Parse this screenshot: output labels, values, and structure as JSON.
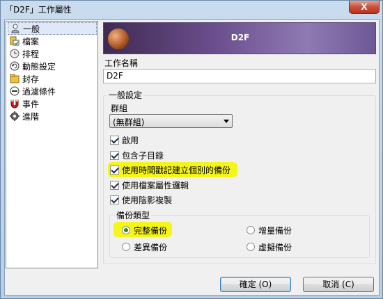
{
  "window": {
    "title": "「D2F」工作屬性",
    "close_label": "X"
  },
  "sidebar": {
    "items": [
      {
        "label": "一般",
        "icon": "user-icon",
        "selected": true
      },
      {
        "label": "檔案",
        "icon": "files-icon"
      },
      {
        "label": "排程",
        "icon": "clock-icon"
      },
      {
        "label": "動態設定",
        "icon": "refresh-icon"
      },
      {
        "label": "封存",
        "icon": "archive-icon"
      },
      {
        "label": "過濾條件",
        "icon": "filter-icon"
      },
      {
        "label": "事件",
        "icon": "magnet-icon"
      },
      {
        "label": "進階",
        "icon": "gear-icon"
      }
    ]
  },
  "banner": {
    "title": "D2F"
  },
  "job_name": {
    "label": "工作名稱",
    "value": "D2F"
  },
  "general": {
    "title": "一般設定",
    "group_label": "群組",
    "group_value": "(無群組)",
    "options": [
      {
        "label": "啟用",
        "checked": true
      },
      {
        "label": "包含子目錄",
        "checked": true
      },
      {
        "label": "使用時間戳記建立個別的備份",
        "checked": true,
        "highlight": true
      },
      {
        "label": "使用檔案屬性邏輯",
        "checked": true
      },
      {
        "label": "使用陰影複製",
        "checked": true
      }
    ]
  },
  "backup_type": {
    "title": "備份類型",
    "options": [
      {
        "label": "完整備份",
        "checked": true,
        "highlight": true
      },
      {
        "label": "增量備份",
        "checked": false
      },
      {
        "label": "差異備份",
        "checked": false
      },
      {
        "label": "虛擬備份",
        "checked": false
      }
    ]
  },
  "buttons": {
    "ok": "確定 (O)",
    "cancel": "取消 (C)"
  },
  "colors": {
    "highlight": "#f5f51a",
    "banner": "#6a4d8c",
    "radio_dot": "#2a8a2a"
  }
}
